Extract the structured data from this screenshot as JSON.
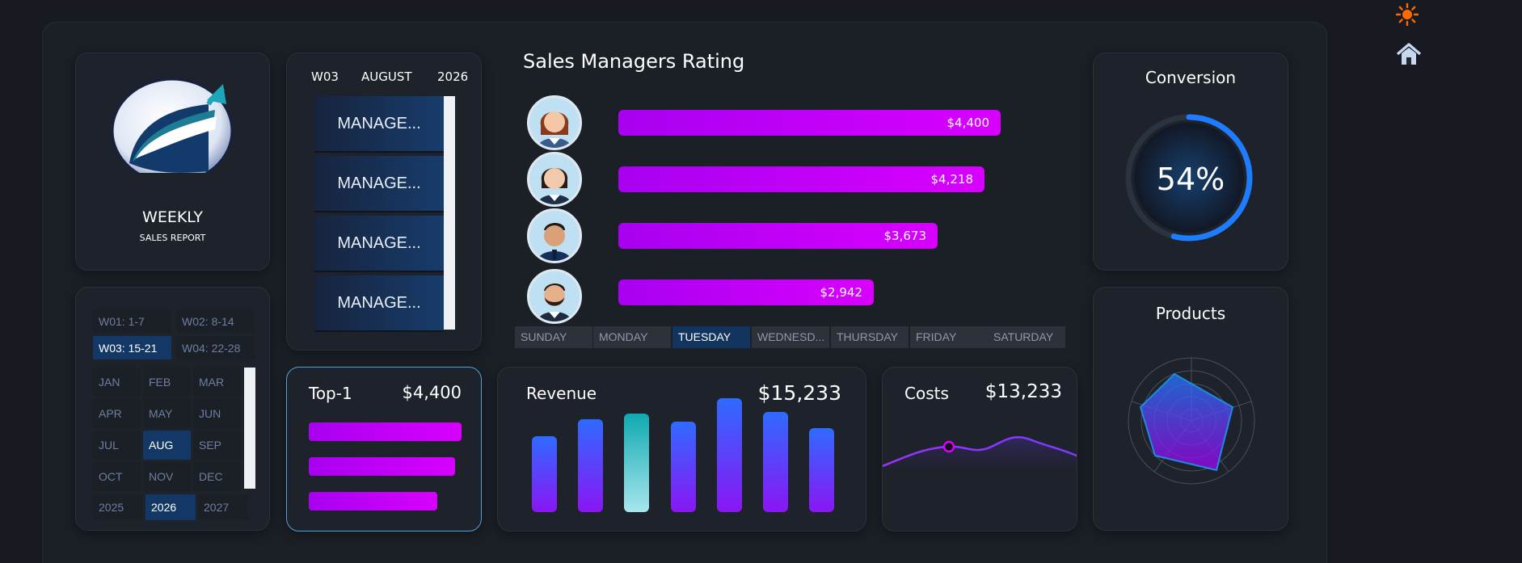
{
  "report": {
    "title": "WEEKLY",
    "subtitle": "SALES REPORT"
  },
  "header": {
    "week": "W03",
    "month": "AUGUST",
    "year": "2026"
  },
  "managers": [
    "MANAGE...",
    "MANAGE...",
    "MANAGE...",
    "MANAGE..."
  ],
  "weeks": [
    "W01: 1-7",
    "W02: 8-14",
    "W03: 15-21",
    "W04: 22-28"
  ],
  "selected_week": "W03: 15-21",
  "months": [
    "JAN",
    "FEB",
    "MAR",
    "APR",
    "MAY",
    "JUN",
    "JUL",
    "AUG",
    "SEP",
    "OCT",
    "NOV",
    "DEC"
  ],
  "selected_month": "AUG",
  "years": [
    "2025",
    "2026",
    "2027"
  ],
  "selected_year": "2026",
  "rating": {
    "title": "Sales Managers Rating",
    "values": [
      "$4,400",
      "$4,218",
      "$3,673",
      "$2,942"
    ],
    "numbers": [
      4400,
      4218,
      3673,
      2942
    ]
  },
  "days": [
    "SUNDAY",
    "MONDAY",
    "TUESDAY",
    "WEDNESD...",
    "THURSDAY",
    "FRIDAY",
    "SATURDAY"
  ],
  "selected_day": "TUESDAY",
  "top1": {
    "label": "Top-1",
    "value": "$4,400",
    "bar_levels": [
      1.0,
      0.96,
      0.84
    ]
  },
  "revenue": {
    "label": "Revenue",
    "value": "$15,233",
    "bar_levels": [
      0.66,
      0.81,
      0.86,
      0.79,
      0.99,
      0.87,
      0.73
    ],
    "highlight_index": 2
  },
  "costs": {
    "label": "Costs",
    "value": "$13,233"
  },
  "conversion": {
    "label": "Conversion",
    "value": "54%",
    "fraction": 0.54
  },
  "products": {
    "label": "Products"
  },
  "colors": {
    "accent": "#d800ff",
    "blue": "#1e7cff",
    "panel": "#1e222a",
    "selected": "#143866"
  },
  "icons": [
    "sun-icon",
    "home-icon"
  ]
}
